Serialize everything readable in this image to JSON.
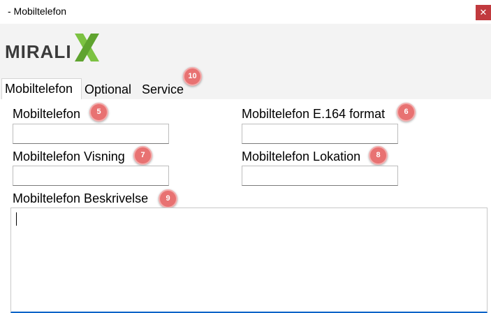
{
  "window": {
    "title": "- Mobiltelefon",
    "close_label": "✕"
  },
  "logo": {
    "text": "MIRALIX",
    "brand_color": "#3a3a3a",
    "accent_color": "#7cc242"
  },
  "tabs": [
    {
      "label": "Mobiltelefon",
      "active": true
    },
    {
      "label": "Optional",
      "active": false
    },
    {
      "label": "Service",
      "active": false,
      "badge": "10"
    }
  ],
  "form": {
    "mobile": {
      "label": "Mobiltelefon",
      "badge": "5",
      "value": ""
    },
    "e164": {
      "label": "Mobiltelefon E.164 format",
      "badge": "6",
      "value": ""
    },
    "display": {
      "label": "Mobiltelefon Visning",
      "badge": "7",
      "value": ""
    },
    "location": {
      "label": "Mobiltelefon Lokation",
      "badge": "8",
      "value": ""
    },
    "description": {
      "label": "Mobiltelefon Beskrivelse",
      "badge": "9",
      "value": ""
    }
  },
  "colors": {
    "badge": "#e87272",
    "close": "#c13a3e",
    "focus": "#0a64c8"
  }
}
